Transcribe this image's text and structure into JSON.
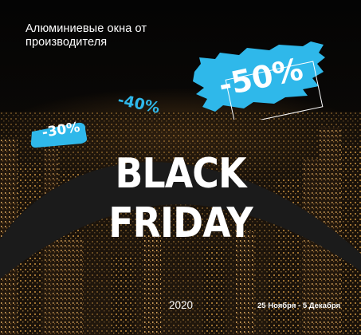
{
  "headline": "Алюминиевые окна от производителя",
  "discounts": {
    "small": "-30%",
    "medium": "-40%",
    "large": "-50%"
  },
  "title": {
    "line1": "BLACK",
    "line2": "FRIDAY"
  },
  "year": "2020",
  "dates": "25 Ноября - 5 Декабря",
  "colors": {
    "accent": "#2fb8ea",
    "background": "#050505",
    "swoosh": "#1b1b1b",
    "text": "#ffffff"
  }
}
